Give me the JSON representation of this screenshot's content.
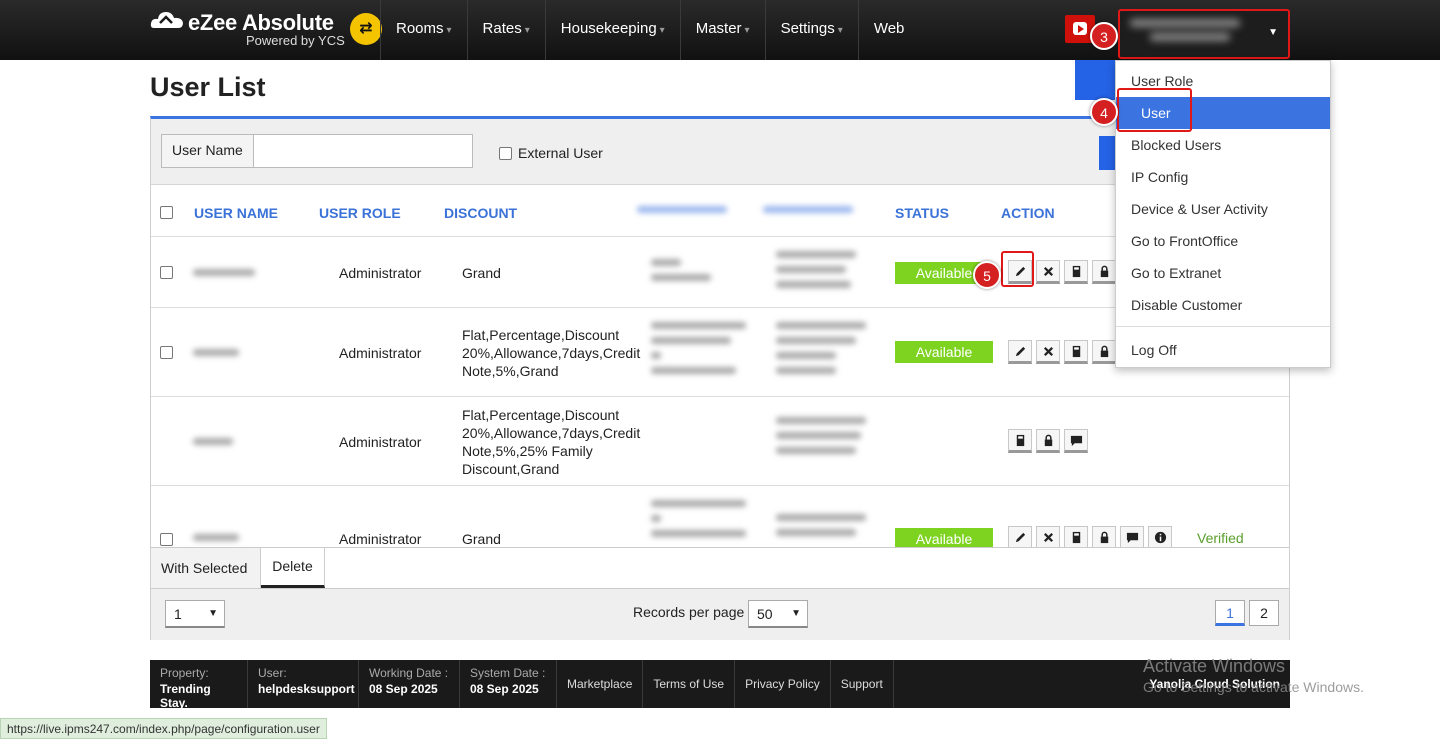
{
  "app": {
    "name": "eZee Absolute",
    "tagline": "Powered by YCS"
  },
  "nav": [
    {
      "label": "Rooms",
      "caret": true
    },
    {
      "label": "Rates",
      "caret": true
    },
    {
      "label": "Housekeeping",
      "caret": true
    },
    {
      "label": "Master",
      "caret": true
    },
    {
      "label": "Settings",
      "caret": true
    },
    {
      "label": "Web",
      "caret": false
    }
  ],
  "badges": {
    "b3": "3",
    "b4": "4",
    "b5": "5"
  },
  "page": {
    "title": "User List"
  },
  "filter": {
    "user_name_label": "User Name",
    "user_name_value": "",
    "external_user_label": "External User"
  },
  "columns": [
    "USER NAME",
    "USER ROLE",
    "DISCOUNT",
    "STATUS",
    "ACTION"
  ],
  "rows": [
    {
      "role": "Administrator",
      "discount": "Grand",
      "status": "Available",
      "verified": ""
    },
    {
      "role": "Administrator",
      "discount": "Flat,Percentage,Discount 20%,Allowance,7days,Credit Note,5%,Grand",
      "status": "Available",
      "verified": ""
    },
    {
      "role": "Administrator",
      "discount": "Flat,Percentage,Discount 20%,Allowance,7days,Credit Note,5%,25% Family Discount,Grand",
      "status": "",
      "verified": ""
    },
    {
      "role": "Administrator",
      "discount": "Grand",
      "status": "Available",
      "verified": "Verified"
    }
  ],
  "bulk": {
    "with_selected": "With Selected",
    "delete": "Delete"
  },
  "pager": {
    "page_select": "1",
    "records_label": "Records per page",
    "records_value": "50",
    "pages": [
      "1",
      "2"
    ]
  },
  "dropdown": {
    "items": [
      "User Role",
      "User",
      "Blocked Users",
      "IP Config",
      "Device & User Activity",
      "Go to FrontOffice",
      "Go to Extranet",
      "Disable Customer",
      "Log Off"
    ]
  },
  "footer": {
    "property_key": "Property:",
    "property_val": "Trending Stay.",
    "user_key": "User:",
    "user_val": "helpdesksupport",
    "wd_key": "Working Date :",
    "wd_val": "08 Sep 2025",
    "sd_key": "System Date :",
    "sd_val": "08 Sep 2025",
    "links": [
      "Marketplace",
      "Terms of Use",
      "Privacy Policy",
      "Support"
    ],
    "brand": "Yanolja Cloud Solution"
  },
  "watermark": {
    "line1": "Activate Windows",
    "line2": "Go to Settings to activate Windows."
  },
  "status_url": "https://live.ipms247.com/index.php/page/configuration.user",
  "colors": {
    "accent": "#3b74e0",
    "available": "#7ed321",
    "highlight": "#e01818",
    "verified": "#5a9e2b"
  }
}
